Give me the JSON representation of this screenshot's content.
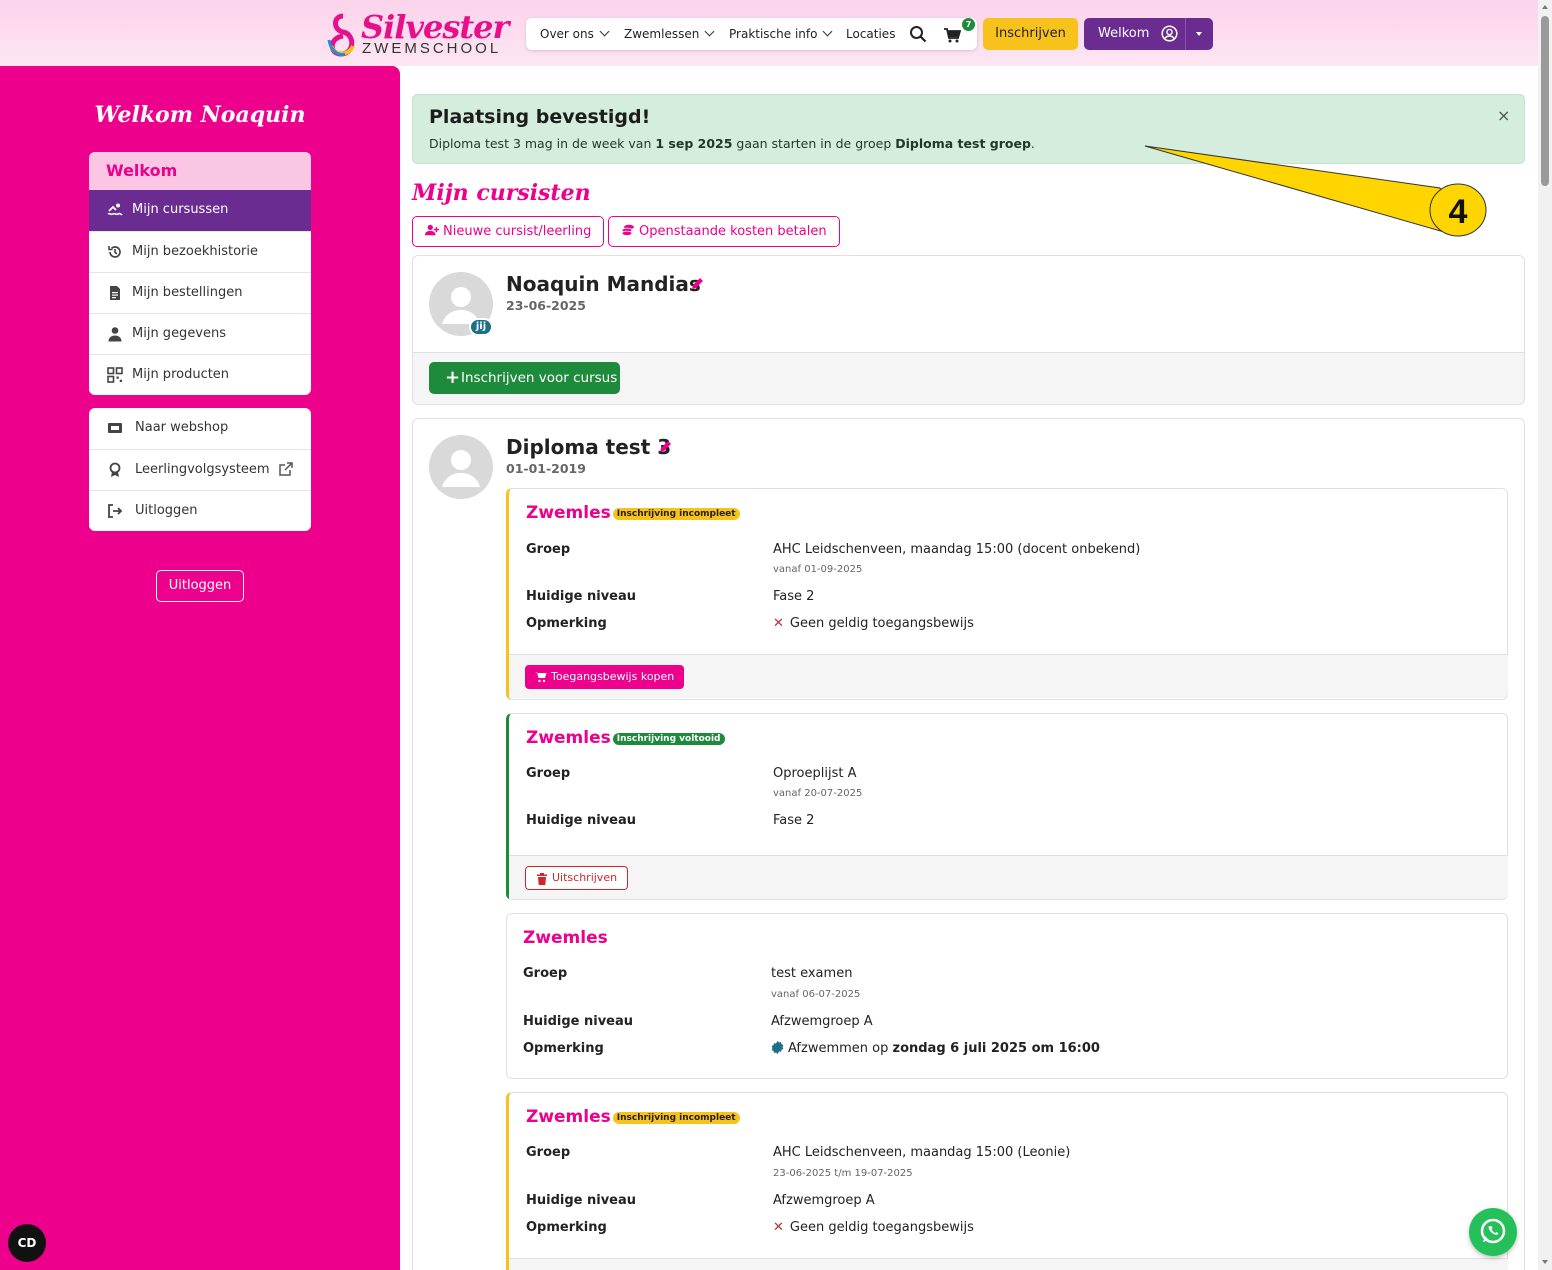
{
  "brand": {
    "name": "Silvester",
    "sub": "ZWEMSCHOOL",
    "color": "#ec008c"
  },
  "nav": {
    "items": [
      "Over ons",
      "Zwemlessen",
      "Praktische info",
      "Locaties"
    ],
    "cart_count": "7",
    "inschrijven": "Inschrijven",
    "welkom": "Welkom"
  },
  "sidebar": {
    "title": "Welkom Noaquin",
    "menu_head": "Welkom",
    "items": [
      "Mijn cursussen",
      "Mijn bezoekhistorie",
      "Mijn bestellingen",
      "Mijn gegevens",
      "Mijn producten"
    ],
    "links": [
      "Naar webshop",
      "Leerlingvolgsysteem",
      "Uitloggen"
    ],
    "logout": "Uitloggen"
  },
  "alert": {
    "title": "Plaatsing bevestigd!",
    "text1": "Diploma test 3 mag in de week van ",
    "date": "1 sep 2025",
    "text2": " gaan starten in de groep ",
    "group": "Diploma test groep",
    "text3": ".",
    "close": "×"
  },
  "main": {
    "title": "Mijn cursisten",
    "btn_new": "Nieuwe cursist/leerling",
    "btn_pay": "Openstaande kosten betalen",
    "callout_number": "4"
  },
  "person1": {
    "name": "Noaquin Mandias",
    "date": "23-06-2025",
    "badge": "jij",
    "enroll": "Inschrijven voor cursus"
  },
  "person2": {
    "name": "Diploma test 3",
    "date": "01-01-2019"
  },
  "labels": {
    "groep": "Groep",
    "niveau": "Huidige niveau",
    "opmerking": "Opmerking"
  },
  "courses": [
    {
      "title": "Zwemles",
      "badge": "Inschrijving incompleet",
      "groep": "AHC Leidschenveen, maandag 15:00 (docent onbekend)",
      "sub": "vanaf 01-09-2025",
      "niveau": "Fase 2",
      "opmerking": "Geen geldig toegangsbewijs",
      "button": "Toegangsbewijs kopen"
    },
    {
      "title": "Zwemles",
      "badge": "Inschrijving voltooid",
      "groep": "Oproeplijst A",
      "sub": "vanaf 20-07-2025",
      "niveau": "Fase 2",
      "button": "Uitschrijven"
    },
    {
      "title": "Zwemles",
      "groep": "test examen",
      "sub": "vanaf 06-07-2025",
      "niveau": "Afzwemgroep A",
      "opm_pre": "Afzwemmen op ",
      "opm_bold": "zondag 6 juli 2025 om 16:00"
    },
    {
      "title": "Zwemles",
      "badge": "Inschrijving incompleet",
      "groep": "AHC Leidschenveen, maandag 15:00 (Leonie)",
      "sub": "23-06-2025 t/m 19-07-2025",
      "niveau": "Afzwemgroep A",
      "opmerking": "Geen geldig toegangsbewijs"
    }
  ],
  "floating": {
    "cc": "CD"
  }
}
